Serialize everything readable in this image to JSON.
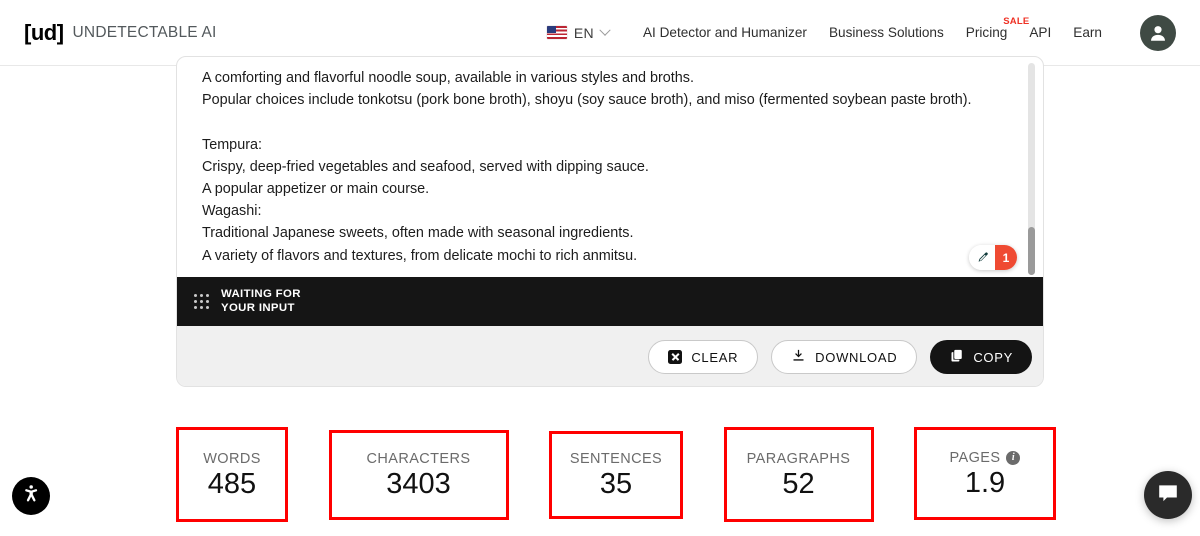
{
  "header": {
    "logo_mark": "[ud]",
    "brand_name": "UNDETECTABLE AI",
    "language": {
      "label": "EN",
      "flag_icon": "us-flag-icon",
      "chevron_icon": "chevron-down-icon"
    },
    "nav_links": [
      {
        "label": "AI Detector and Humanizer"
      },
      {
        "label": "Business Solutions"
      },
      {
        "label": "Pricing",
        "badge": "SALE"
      },
      {
        "label": "API"
      },
      {
        "label": "Earn"
      }
    ],
    "avatar_icon": "user-avatar-icon"
  },
  "editor": {
    "lines": [
      "A comforting and flavorful noodle soup, available in various styles and broths.",
      "Popular choices include tonkotsu (pork bone broth), shoyu (soy sauce broth), and miso (fermented soybean paste broth).",
      "",
      "Tempura:",
      "Crispy, deep-fried vegetables and seafood, served with dipping sauce.",
      "A popular appetizer or main course.",
      "Wagashi:",
      "Traditional Japanese sweets, often made with seasonal ingredients.",
      "A variety of flavors and textures, from delicate mochi to rich anmitsu."
    ],
    "grammar_badge": {
      "count": "1",
      "pen_icon": "grammarly-pen-icon",
      "accent_color": "#ef4a32"
    },
    "scrollbar": {
      "name": "editor-scrollbar"
    }
  },
  "status": {
    "line1": "WAITING FOR",
    "line2": "YOUR INPUT",
    "grid_icon": "dot-grid-icon"
  },
  "actions": {
    "clear": {
      "label": "CLEAR",
      "icon": "close-box-icon"
    },
    "download": {
      "label": "DOWNLOAD",
      "icon": "download-icon"
    },
    "copy": {
      "label": "COPY",
      "icon": "copy-icon"
    }
  },
  "stats": [
    {
      "label": "WORDS",
      "value": "485"
    },
    {
      "label": "CHARACTERS",
      "value": "3403"
    },
    {
      "label": "SENTENCES",
      "value": "35"
    },
    {
      "label": "PARAGRAPHS",
      "value": "52"
    },
    {
      "label": "PAGES",
      "value": "1.9",
      "info_icon": "info-icon"
    }
  ],
  "floating": {
    "accessibility_icon": "accessibility-icon",
    "chat_icon": "chat-bubble-icon"
  },
  "colors": {
    "annotation": "#ff0000",
    "accent_red": "#ef3124",
    "dark": "#141414"
  }
}
